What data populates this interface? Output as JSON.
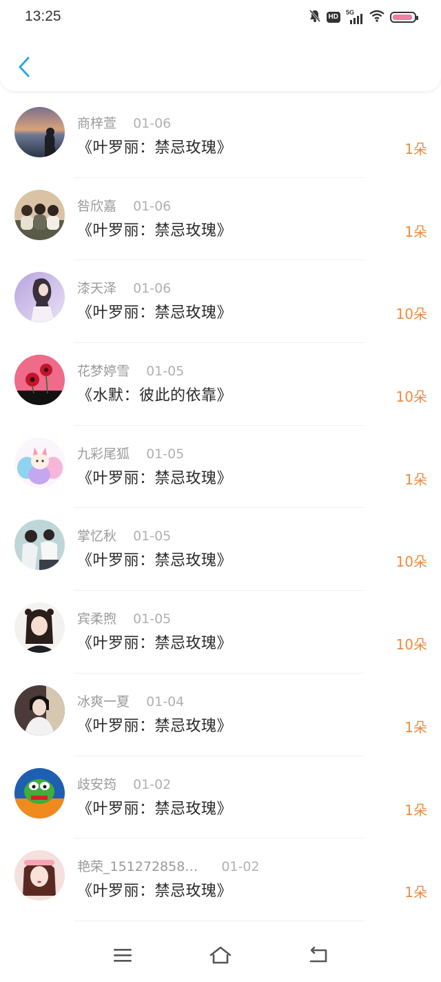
{
  "status_bar": {
    "time": "13:25",
    "hd": "HD",
    "network": "5G",
    "icons": [
      "bell-muted-icon",
      "hd-icon",
      "signal-icon",
      "wifi-icon",
      "battery-icon"
    ]
  },
  "header": {
    "back_icon": "chevron-left-icon",
    "accent_color": "#2aa6e8"
  },
  "colors": {
    "flower_count": "#f08a3c",
    "name": "#9a9a9a",
    "title": "#2a2a2a"
  },
  "gifts": [
    {
      "name": "商梓萱",
      "date": "01-06",
      "book": "《叶罗丽：禁忌玫瑰》",
      "count": "1朵"
    },
    {
      "name": "咎欣嘉",
      "date": "01-06",
      "book": "《叶罗丽：禁忌玫瑰》",
      "count": "1朵"
    },
    {
      "name": "漆天泽",
      "date": "01-06",
      "book": "《叶罗丽：禁忌玫瑰》",
      "count": "10朵"
    },
    {
      "name": "花梦婷雪",
      "date": "01-05",
      "book": "《水默：彼此的依靠》",
      "count": "10朵"
    },
    {
      "name": "九彩尾狐",
      "date": "01-05",
      "book": "《叶罗丽：禁忌玫瑰》",
      "count": "1朵"
    },
    {
      "name": "掌忆秋",
      "date": "01-05",
      "book": "《叶罗丽：禁忌玫瑰》",
      "count": "10朵"
    },
    {
      "name": "宾柔煦",
      "date": "01-05",
      "book": "《叶罗丽：禁忌玫瑰》",
      "count": "10朵"
    },
    {
      "name": "冰爽一夏",
      "date": "01-04",
      "book": "《叶罗丽：禁忌玫瑰》",
      "count": "1朵"
    },
    {
      "name": "歧安筠",
      "date": "01-02",
      "book": "《叶罗丽：禁忌玫瑰》",
      "count": "1朵"
    },
    {
      "name": "艳荣_151272858…",
      "date": "01-02",
      "book": "《叶罗丽：禁忌玫瑰》",
      "count": "1朵"
    }
  ],
  "nav_bar": {
    "icons": [
      "menu-icon",
      "home-icon",
      "back-return-icon"
    ]
  }
}
